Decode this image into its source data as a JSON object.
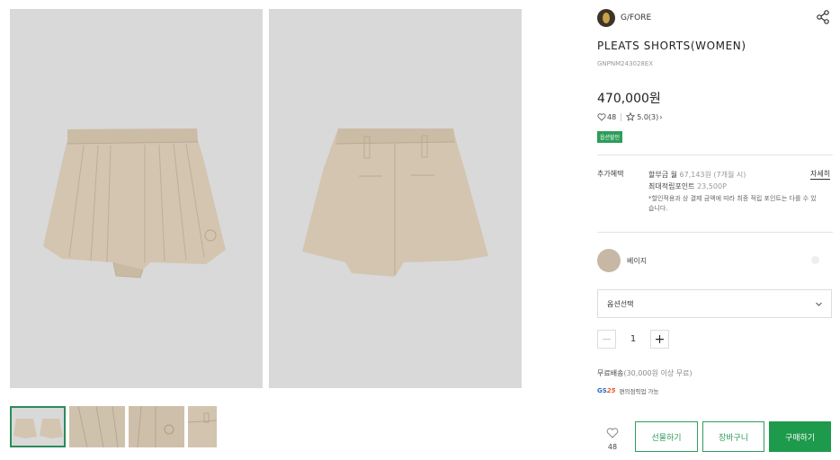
{
  "gallery": {
    "main_images": [
      "front view",
      "back view"
    ],
    "thumbnail_count": 4,
    "active_thumbnail": 0
  },
  "product": {
    "brand": "G/FORE",
    "title": "PLEATS SHORTS(WOMEN)",
    "code": "GNPNM243028EX",
    "price": "470,000원",
    "likes": "48",
    "rating": "5.0",
    "review_count": "(3)",
    "badge": "옵션할인"
  },
  "benefits": {
    "label": "추가혜택",
    "installment_prefix": "할부금 월",
    "installment_amount": "67,143원 (7개월 시)",
    "points_label": "최대적립포인트",
    "points_amount": "23,500P",
    "note": "*할인적용과 상 결제 금액에 따라 최종 적립 포인트는 다를 수 있습니다.",
    "detail_link": "자세히"
  },
  "color": {
    "name": "베이지",
    "hex": "#c6b8a4"
  },
  "option_select": {
    "selected": "옵션선택"
  },
  "quantity": {
    "value": "1",
    "minus": "−",
    "plus": "+"
  },
  "shipping": {
    "label": "무료배송",
    "condition": "(30,000원 이상 무료)"
  },
  "gs": {
    "logo_prefix": "GS",
    "logo_num": "25",
    "text": "편의점픽업 가능"
  },
  "actions": {
    "wish_count": "48",
    "gift": "선물하기",
    "cart": "장바구니",
    "buy": "구매하기"
  },
  "colors": {
    "accent": "#2e9d5a",
    "buy_bg": "#1e9a4c",
    "image_bg": "#d9d9d9",
    "fabric": "#d3c5b0"
  },
  "icons": [
    "share-icon",
    "heart-icon",
    "star-icon",
    "chevron-right-icon",
    "chevron-down-icon"
  ]
}
